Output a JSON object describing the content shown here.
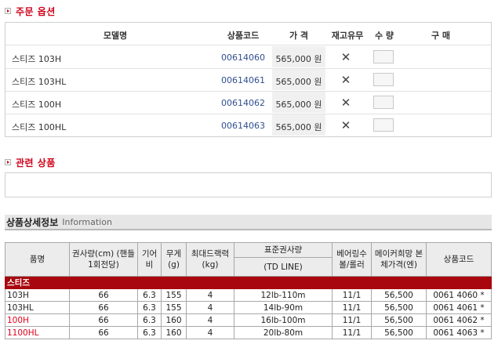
{
  "order_options": {
    "title": "주문 옵션",
    "headers": {
      "model": "모델명",
      "code": "상품코드",
      "price": "가 격",
      "stock": "재고유무",
      "qty": "수 량",
      "buy": "구 매"
    },
    "rows": [
      {
        "model": "스티즈 103H",
        "code": "00614060",
        "price": "565,000 원",
        "stock": "✕"
      },
      {
        "model": "스티즈 103HL",
        "code": "00614061",
        "price": "565,000 원",
        "stock": "✕"
      },
      {
        "model": "스티즈 100H",
        "code": "00614062",
        "price": "565,000 원",
        "stock": "✕"
      },
      {
        "model": "스티즈 100HL",
        "code": "00614063",
        "price": "565,000 원",
        "stock": "✕"
      }
    ]
  },
  "related": {
    "title": "관련 상품"
  },
  "detail": {
    "title_ko": "상품상세정보",
    "title_en": "Information"
  },
  "spec": {
    "headers": {
      "name": "품명",
      "capacity": "권사량(cm) (핸들 1회전당)",
      "gear": "기어비",
      "weight": "무게 (g)",
      "drag": "최대드랙력 (kg)",
      "line_std": "표준권사량",
      "line_sub": "(TD LINE)",
      "bearing": "베어링수 볼/롤러",
      "maker_price": "메이커희망 본체가격(엔)",
      "code": "상품코드"
    },
    "group": "스티즈",
    "rows": [
      {
        "name": "103H",
        "capacity": "66",
        "gear": "6.3",
        "weight": "155",
        "drag": "4",
        "line": "12lb-110m",
        "bearing": "11/1",
        "price": "56,500",
        "code": "0061 4060 *"
      },
      {
        "name": "103HL",
        "capacity": "66",
        "gear": "6.3",
        "weight": "155",
        "drag": "4",
        "line": "14lb-90m",
        "bearing": "11/1",
        "price": "56,500",
        "code": "0061 4061 *"
      },
      {
        "name": "100H",
        "capacity": "66",
        "gear": "6.3",
        "weight": "160",
        "drag": "4",
        "line": "16lb-100m",
        "bearing": "11/1",
        "price": "56,500",
        "code": "0061 4062 *"
      },
      {
        "name": "1100HL",
        "capacity": "66",
        "gear": "6.3",
        "weight": "160",
        "drag": "4",
        "line": "20lb-80m",
        "bearing": "11/1",
        "price": "56,500",
        "code": "0061 4063 *"
      }
    ],
    "red_name_color": "#e0001a",
    "group_color": "#a8070f"
  },
  "colors": {
    "accent": "#d0021b",
    "code_link": "#2f4f8f"
  }
}
